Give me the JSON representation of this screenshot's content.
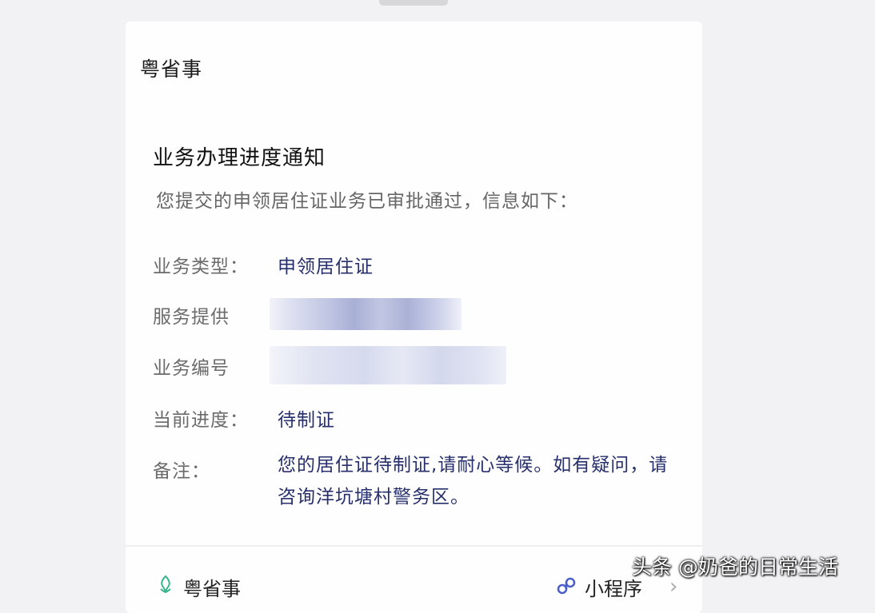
{
  "card": {
    "app_name": "粤省事",
    "notice_title": "业务办理进度通知",
    "notice_desc": "您提交的申领居住证业务已审批通过，信息如下："
  },
  "fields": [
    {
      "label": "业务类型：",
      "value": "申领居住证"
    },
    {
      "label": "服务提供",
      "value": ""
    },
    {
      "label": "业务编号",
      "value": ""
    },
    {
      "label": "当前进度：",
      "value": "待制证"
    },
    {
      "label": "备注：",
      "value": "您的居住证待制证,请耐心等候。如有疑问，请咨询洋坑塘村警务区。"
    }
  ],
  "footer": {
    "app_name": "粤省事",
    "type_label": "小程序",
    "logo_icon": "yueshengshi-logo-icon",
    "link_icon": "mini-program-icon",
    "chevron_icon": "chevron-right-icon"
  },
  "watermark": "头条 @奶爸的日常生活",
  "colors": {
    "page_bg": "#f2f2f4",
    "card_bg": "#fefefe",
    "value_text": "#27306c",
    "logo_green": "#3bb58a",
    "link_blue": "#4a5ec9"
  }
}
